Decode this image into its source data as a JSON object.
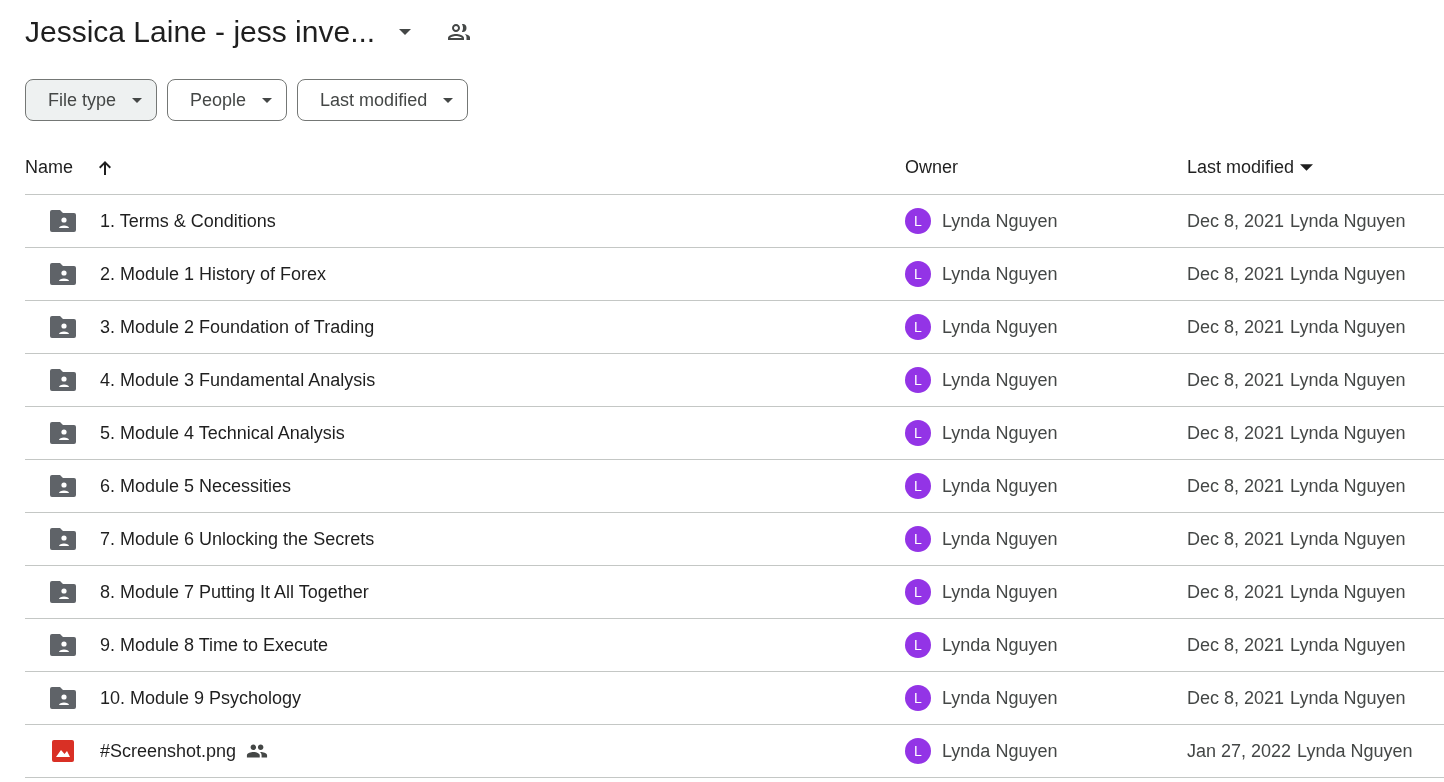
{
  "header": {
    "title": "Jessica Laine - jess inve...",
    "shared": true
  },
  "filters": [
    {
      "label": "File type",
      "selected": true
    },
    {
      "label": "People",
      "selected": false
    },
    {
      "label": "Last modified",
      "selected": false
    }
  ],
  "table": {
    "columns": [
      {
        "label": "Name",
        "sorted_ascending": true,
        "sorted_descending": false
      },
      {
        "label": "Owner",
        "sorted_ascending": false,
        "sorted_descending": false
      },
      {
        "label": "Last modified",
        "sorted_ascending": false,
        "sorted_descending": true
      }
    ],
    "rows": [
      {
        "kind": "folder",
        "name": "1. Terms & Conditions",
        "shared": false,
        "owner": "Lynda Nguyen",
        "avatar": "L",
        "color": "#9334e6",
        "date": "Dec 8, 2021",
        "modified_by": "Lynda Nguyen"
      },
      {
        "kind": "folder",
        "name": "2. Module 1 History of Forex",
        "shared": false,
        "owner": "Lynda Nguyen",
        "avatar": "L",
        "color": "#9334e6",
        "date": "Dec 8, 2021",
        "modified_by": "Lynda Nguyen"
      },
      {
        "kind": "folder",
        "name": "3. Module 2 Foundation of Trading",
        "shared": false,
        "owner": "Lynda Nguyen",
        "avatar": "L",
        "color": "#9334e6",
        "date": "Dec 8, 2021",
        "modified_by": "Lynda Nguyen"
      },
      {
        "kind": "folder",
        "name": "4. Module 3 Fundamental Analysis",
        "shared": false,
        "owner": "Lynda Nguyen",
        "avatar": "L",
        "color": "#9334e6",
        "date": "Dec 8, 2021",
        "modified_by": "Lynda Nguyen"
      },
      {
        "kind": "folder",
        "name": "5. Module 4 Technical Analysis",
        "shared": false,
        "owner": "Lynda Nguyen",
        "avatar": "L",
        "color": "#9334e6",
        "date": "Dec 8, 2021",
        "modified_by": "Lynda Nguyen"
      },
      {
        "kind": "folder",
        "name": "6. Module 5 Necessities",
        "shared": false,
        "owner": "Lynda Nguyen",
        "avatar": "L",
        "color": "#9334e6",
        "date": "Dec 8, 2021",
        "modified_by": "Lynda Nguyen"
      },
      {
        "kind": "folder",
        "name": "7. Module 6 Unlocking the Secrets",
        "shared": false,
        "owner": "Lynda Nguyen",
        "avatar": "L",
        "color": "#9334e6",
        "date": "Dec 8, 2021",
        "modified_by": "Lynda Nguyen"
      },
      {
        "kind": "folder",
        "name": "8. Module 7 Putting It All Together",
        "shared": false,
        "owner": "Lynda Nguyen",
        "avatar": "L",
        "color": "#9334e6",
        "date": "Dec 8, 2021",
        "modified_by": "Lynda Nguyen"
      },
      {
        "kind": "folder",
        "name": "9. Module 8 Time to Execute",
        "shared": false,
        "owner": "Lynda Nguyen",
        "avatar": "L",
        "color": "#9334e6",
        "date": "Dec 8, 2021",
        "modified_by": "Lynda Nguyen"
      },
      {
        "kind": "folder",
        "name": "10. Module 9 Psychology",
        "shared": false,
        "owner": "Lynda Nguyen",
        "avatar": "L",
        "color": "#9334e6",
        "date": "Dec 8, 2021",
        "modified_by": "Lynda Nguyen"
      },
      {
        "kind": "image",
        "name": "#Screenshot.png",
        "shared": true,
        "owner": "Lynda Nguyen",
        "avatar": "L",
        "color": "#9334e6",
        "date": "Jan 27, 2022",
        "modified_by": "Lynda Nguyen"
      }
    ]
  }
}
